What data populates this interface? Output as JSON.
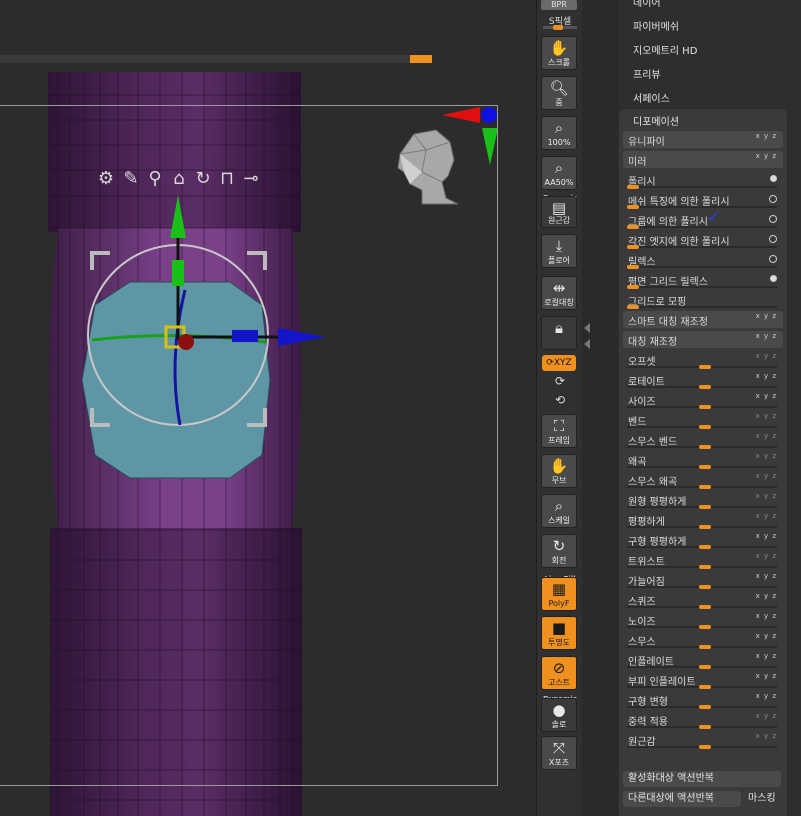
{
  "shelf": {
    "bpr": "BPR",
    "spix": "S픽셀",
    "buttons": [
      {
        "label": "스크롤",
        "icon": "hand-scroll-icon"
      },
      {
        "label": "줌",
        "icon": "zoom-icon"
      },
      {
        "label": "100%",
        "icon": "zoom-100-icon"
      },
      {
        "label": "AA50%",
        "icon": "zoom-aa50-icon"
      },
      {
        "label": "원근감",
        "icon": "perspective-icon",
        "tag": "Dynamic"
      },
      {
        "label": "플로어",
        "icon": "floor-icon"
      },
      {
        "label": "로컬대칭",
        "icon": "local-symmetry-icon"
      },
      {
        "label": "",
        "icon": "lock-icon"
      },
      {
        "label": "프레임",
        "icon": "frame-icon"
      },
      {
        "label": "무브",
        "icon": "move-icon"
      },
      {
        "label": "스케일",
        "icon": "scale-icon"
      },
      {
        "label": "회전",
        "icon": "rotate-icon"
      },
      {
        "label": "PolyF",
        "icon": "polyframe-icon",
        "tag": "Line Fill"
      },
      {
        "label": "투명도",
        "icon": "transparency-icon"
      },
      {
        "label": "고스트",
        "icon": "ghost-icon"
      },
      {
        "label": "솔로",
        "icon": "solo-icon",
        "tag": "Dynamic"
      },
      {
        "label": "X포즈",
        "icon": "xpose-icon"
      }
    ],
    "xyz": "XYZ"
  },
  "palette": {
    "top_items": [
      "데이어",
      "파이버메쉬",
      "지오메트리 HD",
      "프리뷰",
      "서페이스"
    ],
    "deformation_title": "디포메이션",
    "buttons": {
      "unify": "유니파이",
      "mirror": "미러",
      "smart_resym": "스마트 대칭 재조정",
      "resym": "대칭 재조정",
      "repeat_active": "활성화대상 액션반복",
      "repeat_other": "다른대상에 액션반복",
      "masking": "마스킹"
    },
    "polish_rows": [
      {
        "label": "폴리시",
        "radio": "on"
      },
      {
        "label": "메쉬 특징에 의한 폴리시",
        "radio": "off"
      },
      {
        "label": "그룹에 의한 폴리시",
        "radio": "off",
        "checked": "✓"
      },
      {
        "label": "각진 엣지에 의한 폴리시",
        "radio": "off"
      },
      {
        "label": "릴렉스",
        "radio": "off"
      },
      {
        "label": "평면 그리드 릴렉스",
        "radio": "on"
      },
      {
        "label": "그리드로 모핑",
        "radio": ""
      }
    ],
    "slider_rows": [
      {
        "label": "오프셋",
        "axes": "x y z",
        "dim": true
      },
      {
        "label": "로테이트",
        "axes": "x y z",
        "dim": false
      },
      {
        "label": "사이즈",
        "axes": "x y z",
        "dim": false
      },
      {
        "label": "벤드",
        "axes": "x y z",
        "dim": true
      },
      {
        "label": "스무스 벤드",
        "axes": "x y z",
        "dim": true
      },
      {
        "label": "왜곡",
        "axes": "x y z",
        "dim": true
      },
      {
        "label": "스무스 왜곡",
        "axes": "x y z",
        "dim": true
      },
      {
        "label": "원형 평평하게",
        "axes": "x y z",
        "dim": true
      },
      {
        "label": "평평하게",
        "axes": "x y z",
        "dim": true
      },
      {
        "label": "구형 평평하게",
        "axes": "x y z",
        "dim": false
      },
      {
        "label": "트위스트",
        "axes": "x y z",
        "dim": true
      },
      {
        "label": "가늘어짐",
        "axes": "x y z",
        "dim": false
      },
      {
        "label": "스퀴즈",
        "axes": "x y z",
        "dim": false
      },
      {
        "label": "노이즈",
        "axes": "x y z",
        "dim": false
      },
      {
        "label": "스무스",
        "axes": "x y z",
        "dim": false
      },
      {
        "label": "인플레이트",
        "axes": "x y z",
        "dim": false
      },
      {
        "label": "부피 인플레이트",
        "axes": "x y z",
        "dim": false
      },
      {
        "label": "구형 변형",
        "axes": "x y z",
        "dim": false
      },
      {
        "label": "중력 적용",
        "axes": "x y z",
        "dim": true
      },
      {
        "label": "원근감",
        "axes": "x y z",
        "dim": true
      }
    ]
  },
  "colors": {
    "accent": "#f0901e",
    "model_purple": "#5a2e62",
    "mask_blue": "#5e96a6",
    "gizmo_red": "#cc1010",
    "gizmo_green": "#18c018",
    "gizmo_blue": "#1414c8"
  },
  "viewport": {
    "gizmo_icons": [
      "gear-icon",
      "pin-icon",
      "location-icon",
      "home-icon",
      "reset-icon",
      "lock-icon",
      "minus-icon"
    ]
  }
}
